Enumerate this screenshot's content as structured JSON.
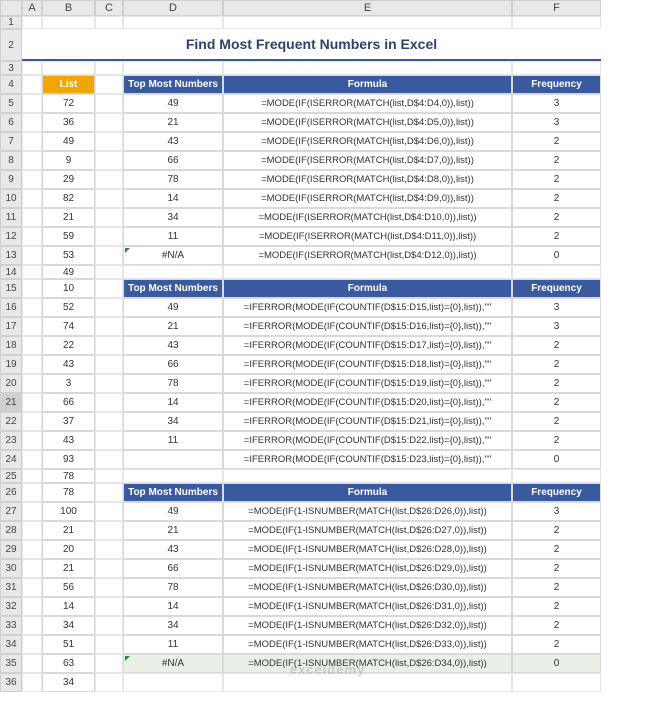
{
  "title": "Find Most Frequent Numbers in Excel",
  "columns": [
    "",
    "A",
    "B",
    "C",
    "D",
    "E",
    "F"
  ],
  "list_header": "List",
  "hdr_top": "Top Most Numbers",
  "hdr_formula": "Formula",
  "hdr_freq": "Frequency",
  "watermark": "exceldemy",
  "list": [
    "72",
    "36",
    "49",
    "9",
    "29",
    "82",
    "21",
    "59",
    "53",
    "49",
    "10",
    "52",
    "74",
    "22",
    "43",
    "3",
    "66",
    "37",
    "43",
    "93",
    "78",
    "78",
    "100",
    "21",
    "20",
    "21",
    "56",
    "14",
    "34",
    "51",
    "63",
    "34"
  ],
  "rows_start": 5,
  "rows_end": 36,
  "t1": [
    {
      "n": "49",
      "f": "=MODE(IF(ISERROR(MATCH(list,D$4:D4,0)),list))",
      "q": "3"
    },
    {
      "n": "21",
      "f": "=MODE(IF(ISERROR(MATCH(list,D$4:D5,0)),list))",
      "q": "3"
    },
    {
      "n": "43",
      "f": "=MODE(IF(ISERROR(MATCH(list,D$4:D6,0)),list))",
      "q": "2"
    },
    {
      "n": "66",
      "f": "=MODE(IF(ISERROR(MATCH(list,D$4:D7,0)),list))",
      "q": "2"
    },
    {
      "n": "78",
      "f": "=MODE(IF(ISERROR(MATCH(list,D$4:D8,0)),list))",
      "q": "2"
    },
    {
      "n": "14",
      "f": "=MODE(IF(ISERROR(MATCH(list,D$4:D9,0)),list))",
      "q": "2"
    },
    {
      "n": "34",
      "f": "=MODE(IF(ISERROR(MATCH(list,D$4:D10,0)),list))",
      "q": "2"
    },
    {
      "n": "11",
      "f": "=MODE(IF(ISERROR(MATCH(list,D$4:D11,0)),list))",
      "q": "2"
    },
    {
      "n": "#N/A",
      "f": "=MODE(IF(ISERROR(MATCH(list,D$4:D12,0)),list))",
      "q": "0"
    }
  ],
  "t2": [
    {
      "n": "49",
      "f": "=IFERROR(MODE(IF(COUNTIF(D$15:D15,list)={0},list)),\"\"",
      "q": "3"
    },
    {
      "n": "21",
      "f": "=IFERROR(MODE(IF(COUNTIF(D$15:D16,list)={0},list)),\"\"",
      "q": "3"
    },
    {
      "n": "43",
      "f": "=IFERROR(MODE(IF(COUNTIF(D$15:D17,list)={0},list)),\"\"",
      "q": "2"
    },
    {
      "n": "66",
      "f": "=IFERROR(MODE(IF(COUNTIF(D$15:D18,list)={0},list)),\"\"",
      "q": "2"
    },
    {
      "n": "78",
      "f": "=IFERROR(MODE(IF(COUNTIF(D$15:D19,list)={0},list)),\"\"",
      "q": "2"
    },
    {
      "n": "14",
      "f": "=IFERROR(MODE(IF(COUNTIF(D$15:D20,list)={0},list)),\"\"",
      "q": "2"
    },
    {
      "n": "34",
      "f": "=IFERROR(MODE(IF(COUNTIF(D$15:D21,list)={0},list)),\"\"",
      "q": "2"
    },
    {
      "n": "11",
      "f": "=IFERROR(MODE(IF(COUNTIF(D$15:D22,list)={0},list)),\"\"",
      "q": "2"
    },
    {
      "n": "",
      "f": "=IFERROR(MODE(IF(COUNTIF(D$15:D23,list)={0},list)),\"\"",
      "q": "0"
    }
  ],
  "t3": [
    {
      "n": "49",
      "f": "=MODE(IF(1-ISNUMBER(MATCH(list,D$26:D26,0)),list))",
      "q": "3"
    },
    {
      "n": "21",
      "f": "=MODE(IF(1-ISNUMBER(MATCH(list,D$26:D27,0)),list))",
      "q": "2"
    },
    {
      "n": "43",
      "f": "=MODE(IF(1-ISNUMBER(MATCH(list,D$26:D28,0)),list))",
      "q": "2"
    },
    {
      "n": "66",
      "f": "=MODE(IF(1-ISNUMBER(MATCH(list,D$26:D29,0)),list))",
      "q": "2"
    },
    {
      "n": "78",
      "f": "=MODE(IF(1-ISNUMBER(MATCH(list,D$26:D30,0)),list))",
      "q": "2"
    },
    {
      "n": "14",
      "f": "=MODE(IF(1-ISNUMBER(MATCH(list,D$26:D31,0)),list))",
      "q": "2"
    },
    {
      "n": "34",
      "f": "=MODE(IF(1-ISNUMBER(MATCH(list,D$26:D32,0)),list))",
      "q": "2"
    },
    {
      "n": "11",
      "f": "=MODE(IF(1-ISNUMBER(MATCH(list,D$26:D33,0)),list))",
      "q": "2"
    },
    {
      "n": "#N/A",
      "f": "=MODE(IF(1-ISNUMBER(MATCH(list,D$26:D34,0)),list))",
      "q": "0"
    }
  ]
}
